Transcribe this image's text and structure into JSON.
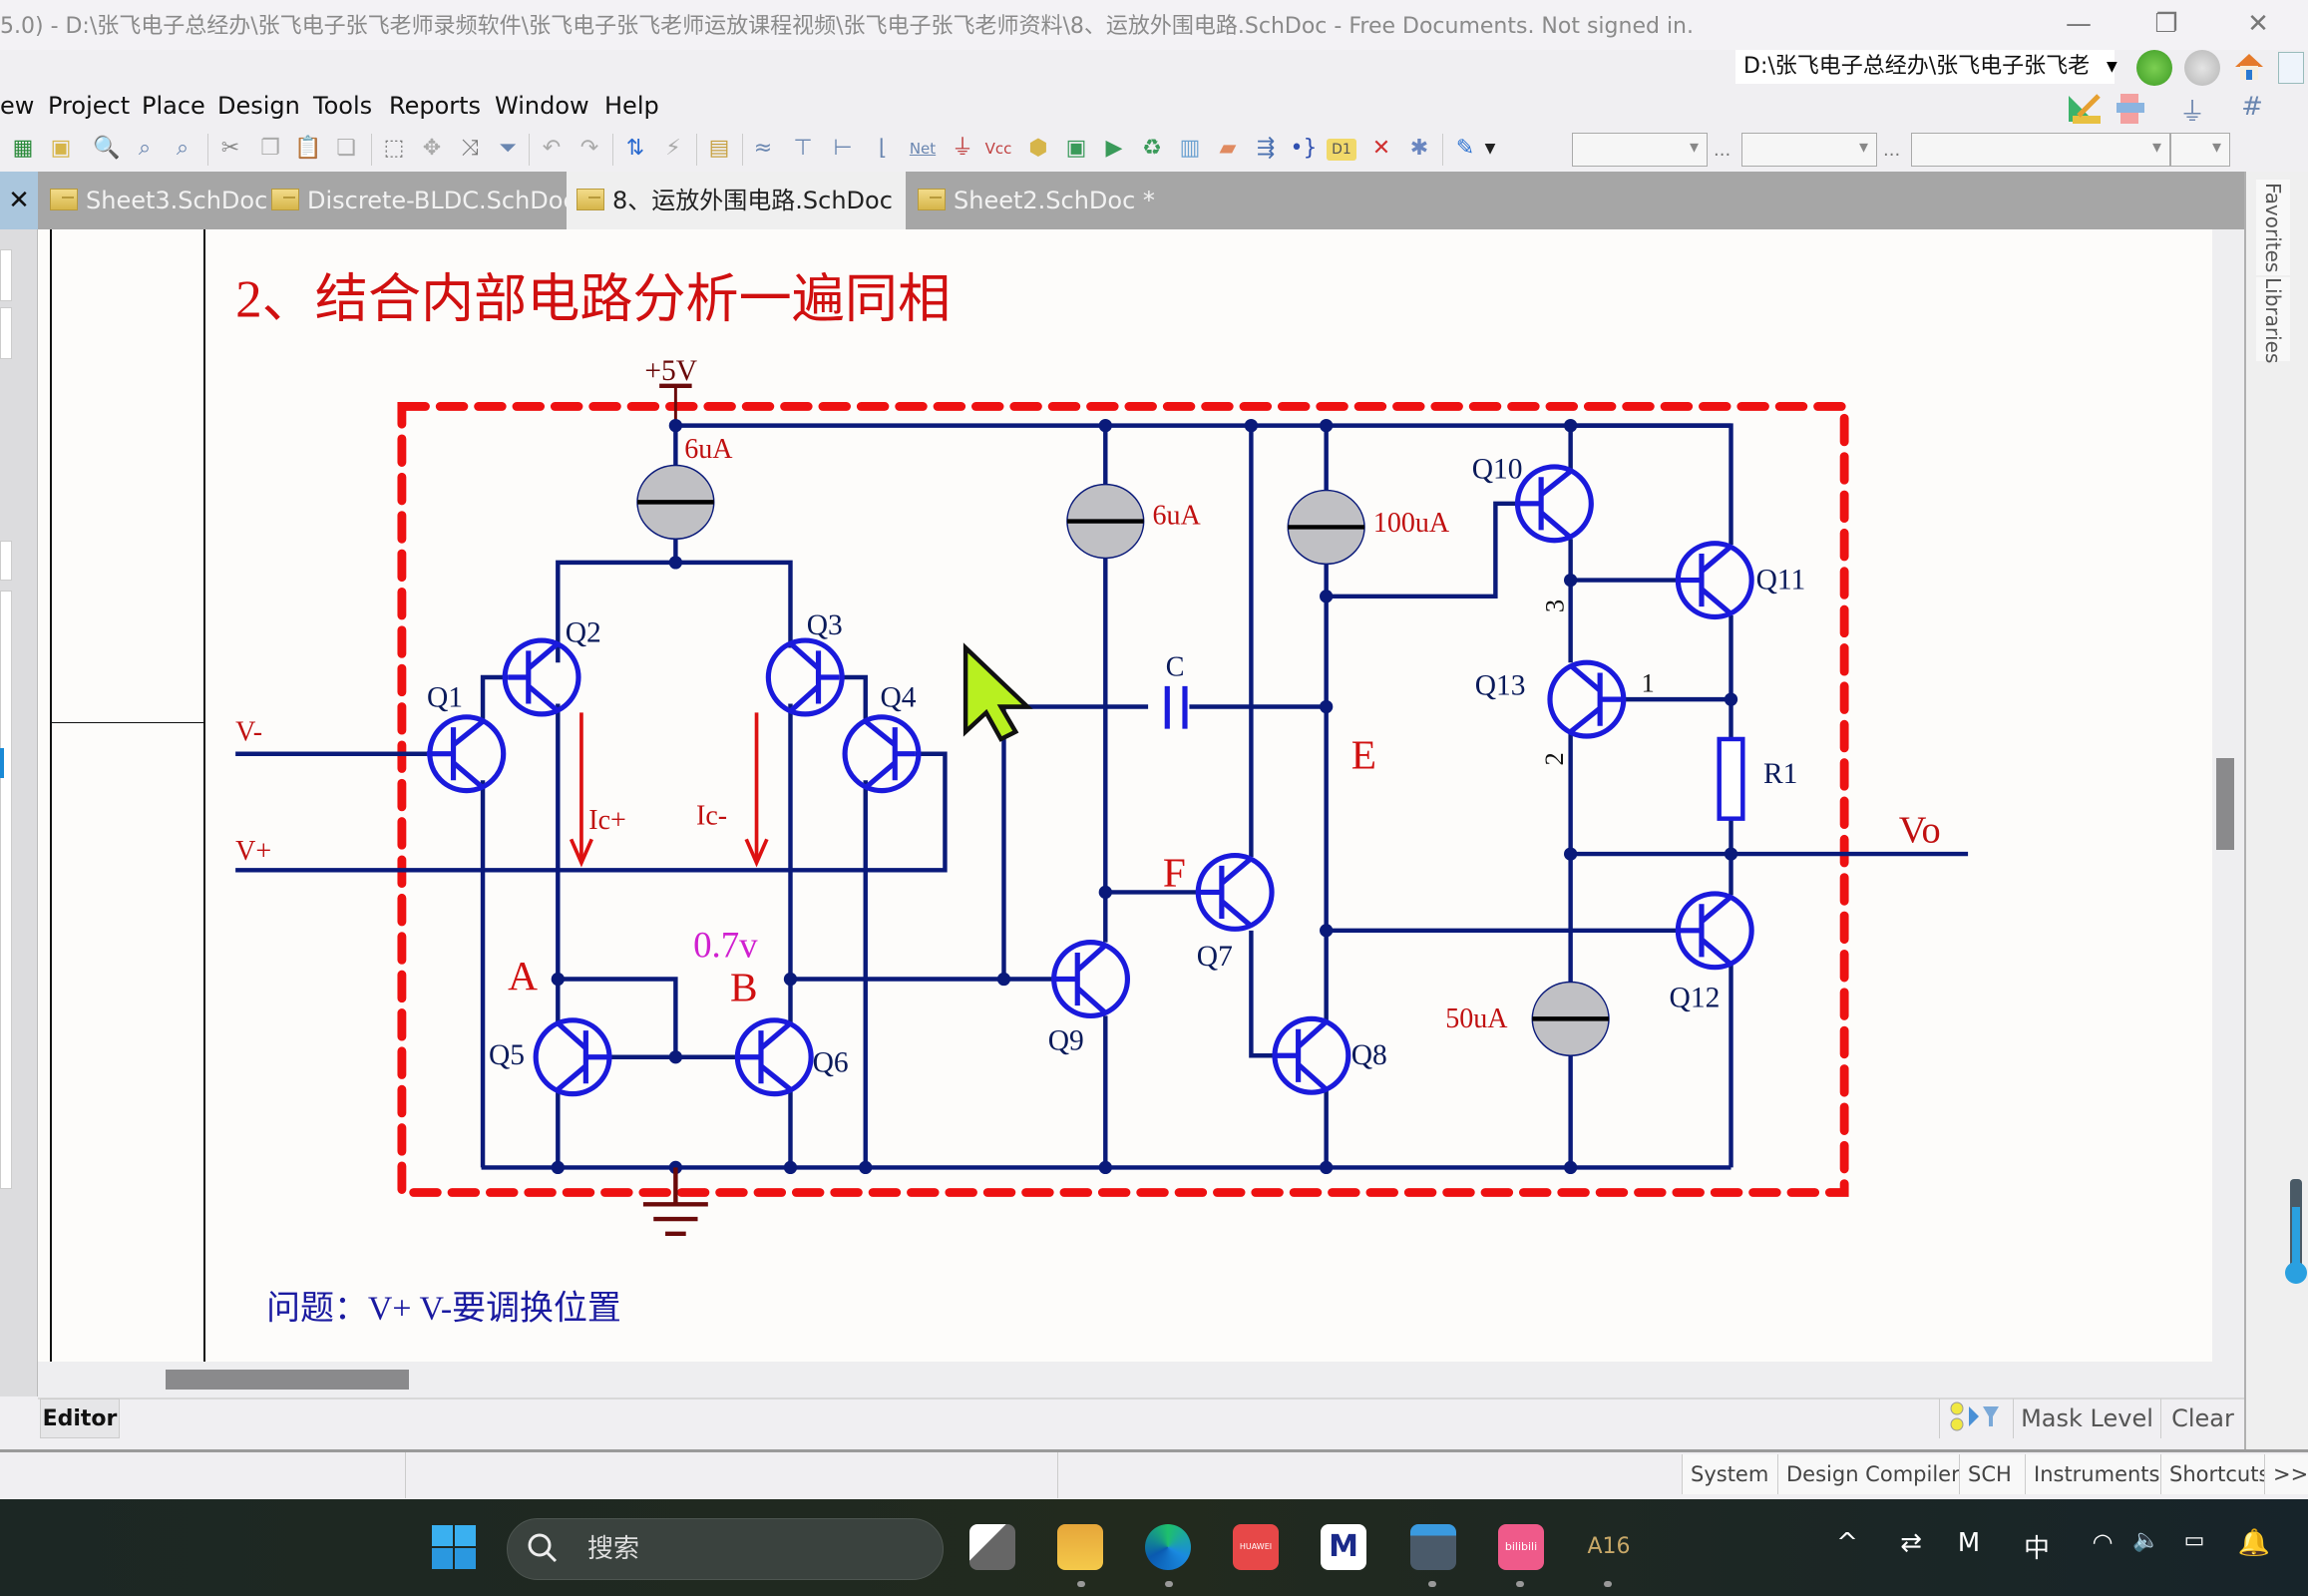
{
  "window": {
    "title": "5.0) - D:\\张飞电子总经办\\张飞电子张飞老师录频软件\\张飞电子张飞老师运放课程视频\\张飞电子张飞老师资料\\8、运放外围电路.SchDoc - Free Documents. Not signed in.",
    "minimize_label": "—",
    "maximize_label": "❐",
    "close_label": "✕"
  },
  "navigation": {
    "path": "D:\\张飞电子总经办\\张飞电子张飞老",
    "dropdown_glyph": "▼"
  },
  "menu": {
    "items": [
      "ew",
      "Project",
      "Place",
      "Design",
      "Tools",
      "Reports",
      "Window",
      "Help"
    ]
  },
  "toolbar": {
    "icons": [
      "open-project-icon",
      "board-icon",
      "open-docs-icon",
      "zoom-fit-icon",
      "zoom-area-icon",
      "zoom-selected-icon",
      "cut-icon",
      "copy-icon",
      "paste-icon",
      "rubber-stamp-icon",
      "select-area-icon",
      "move-icon",
      "cross-probe-icon",
      "clear-filter-icon",
      "undo-icon",
      "redo-icon",
      "hierarchy-icon",
      "compile-icon",
      "browse-library-icon",
      "wire-icon",
      "bus-icon",
      "bus-entry-icon",
      "net-label-icon",
      "net-flag-icon",
      "gnd-port-icon",
      "vcc-port-icon",
      "port-icon",
      "sheet-symbol-icon",
      "sheet-entry-icon",
      "device-sheet-icon",
      "harness-icon",
      "harness-entry-icon",
      "signal-harness-icon",
      "harness-connector-icon",
      "part-icon",
      "no-erc-icon",
      "diff-pair-icon",
      "pen-icon"
    ],
    "net_label": "Net",
    "vcc_label": "Vcc",
    "d1_label": "D1",
    "combo_ellipsis": "..."
  },
  "tabs": [
    {
      "label": "Sheet3.SchDoc",
      "active": false
    },
    {
      "label": "Discrete-BLDC.SchDoc",
      "active": false
    },
    {
      "label": "8、运放外围电路.SchDoc",
      "active": true
    },
    {
      "label": "Sheet2.SchDoc *",
      "active": false
    }
  ],
  "tabstrip_close": "✕",
  "right_dock": {
    "tabs": [
      "Favorites",
      "Libraries"
    ]
  },
  "schematic": {
    "heading": "2、结合内部电路分析一遍同相",
    "note": "问题：V+ V-要调换位置",
    "supply": "+5V",
    "current_sources": [
      "6uA",
      "6uA",
      "100uA",
      "50uA"
    ],
    "transistors": [
      "Q1",
      "Q2",
      "Q3",
      "Q4",
      "Q5",
      "Q6",
      "Q7",
      "Q8",
      "Q9",
      "Q10",
      "Q11",
      "Q12",
      "Q13"
    ],
    "inputs": {
      "minus": "V-",
      "plus": "V+"
    },
    "output": "Vo",
    "currents": {
      "ic_plus": "Ic+",
      "ic_minus": "Ic-"
    },
    "nodes": {
      "a": "A",
      "b": "B",
      "e": "E",
      "f": "F"
    },
    "voltage_annotation": "0.7v",
    "capacitor": "C",
    "resistor": "R1",
    "pin_labels": {
      "p1": "1",
      "p2": "2",
      "p3": "3"
    },
    "colors": {
      "wire": "#0a1a7a",
      "transistor": "#1a1adc",
      "label_red": "#d01010",
      "label_magenta": "#d020d0",
      "boundary": "#ee1111",
      "source_fill": "#c0c0c4",
      "cursor": "#b8f020"
    }
  },
  "editor": {
    "tab_label": "Editor",
    "mask_level": "Mask Level",
    "clear": "Clear"
  },
  "statusbar": {
    "buttons": [
      "System",
      "Design Compiler",
      "SCH",
      "Instruments",
      "Shortcuts",
      ">>"
    ]
  },
  "taskbar": {
    "search_placeholder": "搜索",
    "apps": [
      "task-view",
      "file-explorer",
      "edge",
      "huawei",
      "mindmaster",
      "calculator",
      "bilibili",
      "altium-designer"
    ],
    "huawei_label": "HUAWEI",
    "bilibili_label": "bilibili",
    "tray": [
      "^",
      "⇄",
      "M",
      "中",
      "wifi",
      "volume",
      "battery",
      "bell"
    ]
  }
}
